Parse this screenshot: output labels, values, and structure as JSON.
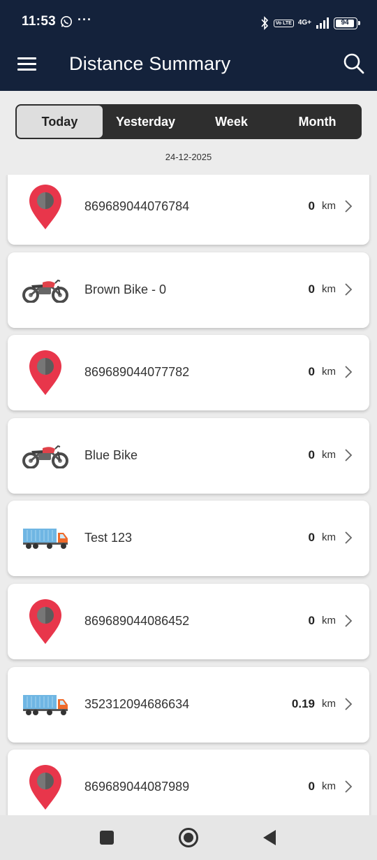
{
  "status": {
    "time": "11:53",
    "volte": "Vo LTE",
    "network": "4G+",
    "battery": "94"
  },
  "appbar": {
    "title": "Distance Summary"
  },
  "tabs": [
    {
      "label": "Today",
      "active": true
    },
    {
      "label": "Yesterday",
      "active": false
    },
    {
      "label": "Week",
      "active": false
    },
    {
      "label": "Month",
      "active": false
    }
  ],
  "date": "24-12-2025",
  "unit": "km",
  "vehicles": [
    {
      "icon": "map-pin-icon",
      "name": "869689044076784",
      "distance": "0"
    },
    {
      "icon": "motorcycle-icon",
      "name": "Brown Bike - 0",
      "distance": "0"
    },
    {
      "icon": "map-pin-icon",
      "name": "869689044077782",
      "distance": "0"
    },
    {
      "icon": "motorcycle-icon",
      "name": "Blue Bike",
      "distance": "0"
    },
    {
      "icon": "truck-icon",
      "name": "Test 123",
      "distance": "0"
    },
    {
      "icon": "map-pin-icon",
      "name": "869689044086452",
      "distance": "0"
    },
    {
      "icon": "truck-icon",
      "name": "352312094686634",
      "distance": "0.19"
    },
    {
      "icon": "map-pin-icon",
      "name": "869689044087989",
      "distance": "0"
    }
  ],
  "colors": {
    "header": "#14223b",
    "pin": "#e8364b",
    "pin_center": "#777777",
    "truck_container": "#6fb6e3",
    "truck_cab": "#ef6a2a",
    "bike_tank": "#e0424a"
  }
}
